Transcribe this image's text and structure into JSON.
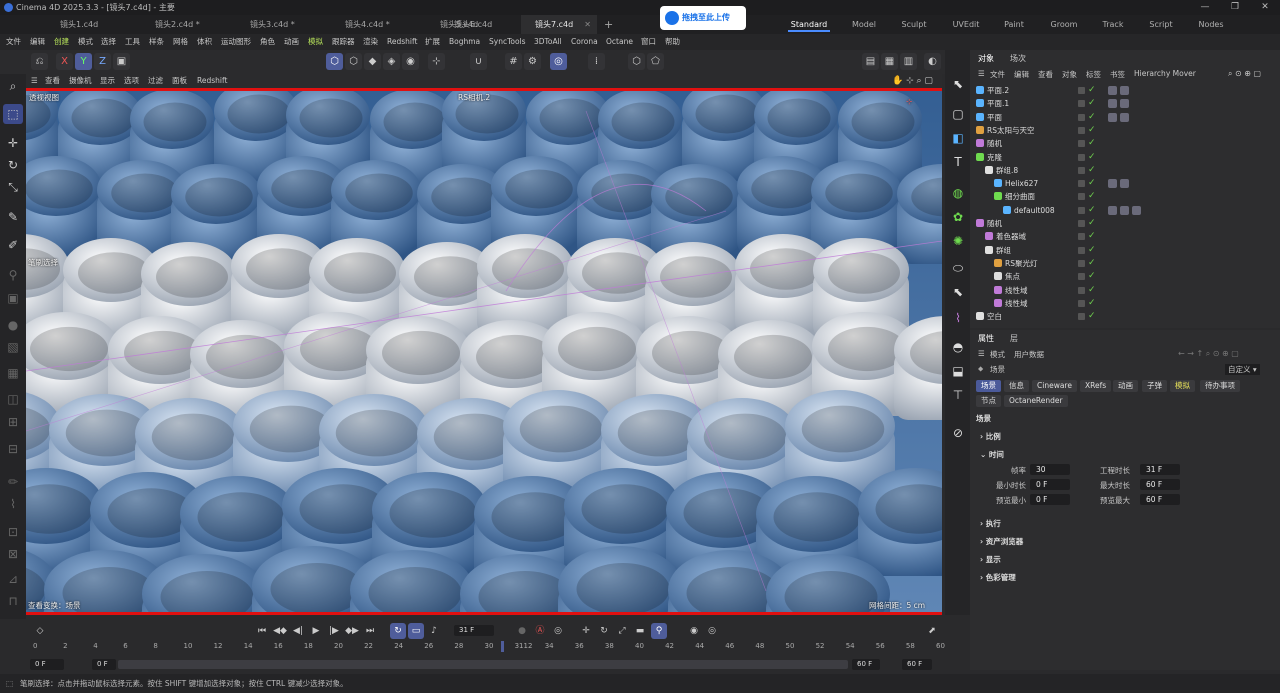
{
  "window": {
    "title": "Cinema 4D 2025.3.3 - [镜头7.c4d] - 主要",
    "controls": [
      "—",
      "❐",
      "✕"
    ]
  },
  "doc_tabs": [
    {
      "label": "镜头1.c4d"
    },
    {
      "label": "镜头2.c4d *"
    },
    {
      "label": "镜头3.c4d *"
    },
    {
      "label": "镜头4.c4d *"
    },
    {
      "label": "镜头5.c4d"
    },
    {
      "label": "镜头6.c4d"
    },
    {
      "label": "镜头7.c4d"
    }
  ],
  "new_tab": "+",
  "upload_button": "拖拽至此上传",
  "layouts": [
    "Standard",
    "Model",
    "Sculpt",
    "UVEdit",
    "Paint",
    "Groom",
    "Track",
    "Script",
    "Nodes"
  ],
  "menu": [
    "文件",
    "编辑",
    "创建",
    "模式",
    "选择",
    "工具",
    "样条",
    "网格",
    "体积",
    "运动图形",
    "角色",
    "动画",
    "模拟",
    "跟踪器",
    "渲染",
    "Redshift",
    "扩展",
    "Boghma",
    "SyncTools",
    "3DToAll",
    "Corona",
    "Octane",
    "窗口",
    "帮助"
  ],
  "toolbar": {
    "axis_x": "X",
    "axis_y": "Y",
    "axis_z": "Z"
  },
  "viewport_menu": [
    "查看",
    "摄像机",
    "显示",
    "选项",
    "过滤",
    "面板",
    "Redshift"
  ],
  "viewport": {
    "label": "透视视图",
    "camera": "RS相机.2",
    "brush_label": "笔刷选择",
    "transform_info": "查看变换：场景",
    "grid_info": "网格间距：5 cm"
  },
  "panel_tabs": {
    "objects": "对象",
    "scene": "场次"
  },
  "obj_menu": [
    "文件",
    "编辑",
    "查看",
    "对象",
    "标签",
    "书签",
    "Hierarchy Mover"
  ],
  "objects": [
    {
      "name": "平面.2",
      "indent": 0,
      "tags": 2
    },
    {
      "name": "平面.1",
      "indent": 0,
      "tags": 2
    },
    {
      "name": "平面",
      "indent": 0,
      "tags": 2
    },
    {
      "name": "RS太阳与天空",
      "indent": 0,
      "tags": 0
    },
    {
      "name": "随机",
      "indent": 0,
      "tags": 0
    },
    {
      "name": "克隆",
      "indent": 0,
      "tags": 0
    },
    {
      "name": "群组.8",
      "indent": 1,
      "tags": 0
    },
    {
      "name": "Helix627",
      "indent": 2,
      "tags": 2
    },
    {
      "name": "细分曲面",
      "indent": 2,
      "tags": 0
    },
    {
      "name": "default008",
      "indent": 3,
      "tags": 3
    },
    {
      "name": "随机",
      "indent": 0,
      "tags": 0
    },
    {
      "name": "着色器域",
      "indent": 1,
      "tags": 0
    },
    {
      "name": "群组",
      "indent": 1,
      "tags": 0
    },
    {
      "name": "RS聚光灯",
      "indent": 2,
      "tags": 0
    },
    {
      "name": "焦点",
      "indent": 2,
      "tags": 0
    },
    {
      "name": "线性域",
      "indent": 2,
      "tags": 0
    },
    {
      "name": "线性域",
      "indent": 2,
      "tags": 0
    },
    {
      "name": "空白",
      "indent": 0,
      "tags": 0
    }
  ],
  "attr_tabs": {
    "attributes": "属性",
    "layers": "层"
  },
  "attr_menu": {
    "mode": "模式",
    "userdata": "用户数据",
    "custom": "自定义"
  },
  "attr_object": "场景",
  "attr_subtabs": [
    "场景",
    "信息",
    "Cineware",
    "XRefs",
    "动画",
    "子弹",
    "模拟",
    "待办事项",
    "节点",
    "OctaneRender"
  ],
  "attr_section_title": "场景",
  "attr_sections": [
    "比例",
    "时间",
    "执行",
    "资产浏览器",
    "显示",
    "色彩管理"
  ],
  "time_fields": [
    {
      "label": "帧率",
      "value": "30",
      "label2": "工程时长",
      "value2": "31 F"
    },
    {
      "label": "最小时长",
      "value": "0 F",
      "label2": "最大时长",
      "value2": "60 F"
    },
    {
      "label": "预览最小",
      "value": "0 F",
      "label2": "预览最大",
      "value2": "60 F"
    }
  ],
  "timeline": {
    "current_frame": "31 F",
    "ticks": [
      "0",
      "2",
      "4",
      "6",
      "8",
      "10",
      "12",
      "14",
      "16",
      "18",
      "20",
      "22",
      "24",
      "26",
      "28",
      "30",
      "3112",
      "34",
      "36",
      "38",
      "40",
      "42",
      "44",
      "46",
      "48",
      "50",
      "52",
      "54",
      "56",
      "58",
      "60"
    ],
    "start": "0 F",
    "preview_start": "0 F",
    "preview_end": "60 F",
    "end": "60 F"
  },
  "status_text": "笔刷选择：点击并拖动鼠标选择元素。按住 SHIFT 键增加选择对象；按住 CTRL 键减少选择对象。",
  "colors": {
    "accent": "#4f5d9b",
    "highlight": "#b5e05a",
    "viewport_border": "#e01010",
    "check": "#6fcf4f"
  }
}
